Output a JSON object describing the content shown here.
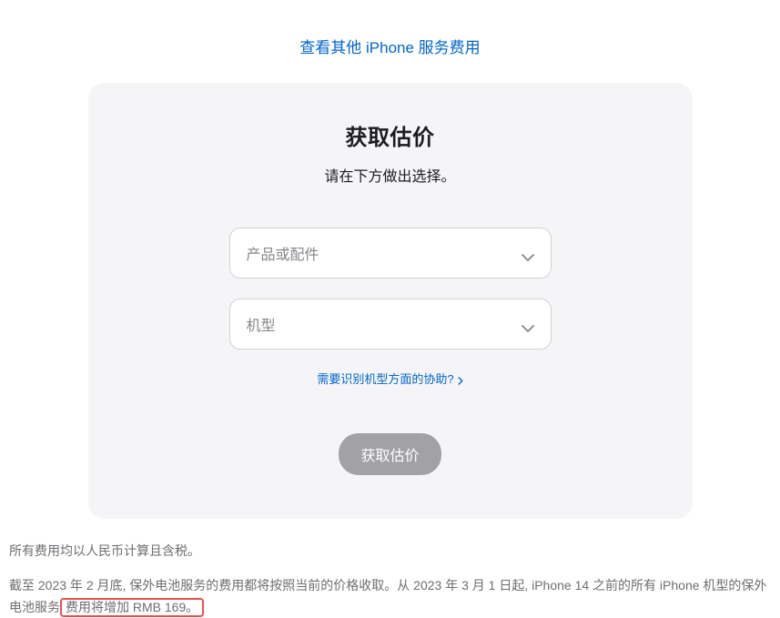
{
  "top_link": {
    "label": "查看其他 iPhone 服务费用"
  },
  "card": {
    "title": "获取估价",
    "subtitle": "请在下方做出选择。",
    "select_product_placeholder": "产品或配件",
    "select_model_placeholder": "机型",
    "help_link_label": "需要识别机型方面的协助?",
    "submit_label": "获取估价"
  },
  "footer": {
    "line1": "所有费用均以人民币计算且含税。",
    "line2_prefix": "截至 2023 年 2 月底, 保外电池服务的费用都将按照当前的价格收取。从 2023 年 3 月 1 日起, iPhone 14 之前的所有 iPhone 机型的保外电池服务",
    "line2_highlight": "费用将增加 RMB 169。"
  }
}
